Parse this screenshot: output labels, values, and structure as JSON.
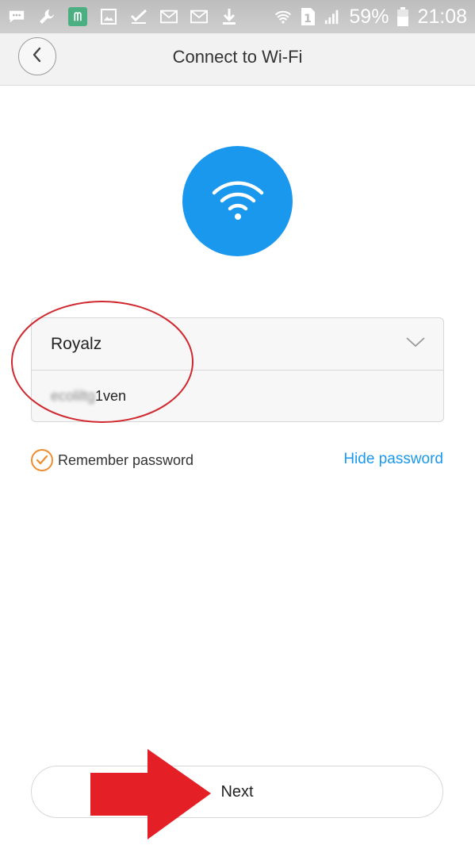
{
  "status_bar": {
    "battery_percent": "59%",
    "time": "21:08",
    "sim_slot": "1",
    "icons": [
      "message-icon",
      "wrench-icon",
      "mi-app-icon",
      "image-icon",
      "check-icon",
      "gmail-icon",
      "gmail-icon",
      "download-icon",
      "wifi-icon",
      "sim-icon",
      "signal-icon",
      "battery-icon"
    ]
  },
  "header": {
    "title": "Connect to Wi-Fi",
    "back_icon": "chevron-left-icon"
  },
  "form": {
    "ssid_value": "Royalz",
    "password_hidden_part": "ecoliltg",
    "password_visible_part": "1ven"
  },
  "options": {
    "remember_label": "Remember password",
    "remember_checked": true,
    "hide_password_label": "Hide password"
  },
  "actions": {
    "next_label": "Next"
  },
  "colors": {
    "accent_blue": "#1a98ee",
    "check_orange": "#f08c2e",
    "annotation_red": "#e41f26",
    "status_bar_gray": "#c4c4c4"
  }
}
